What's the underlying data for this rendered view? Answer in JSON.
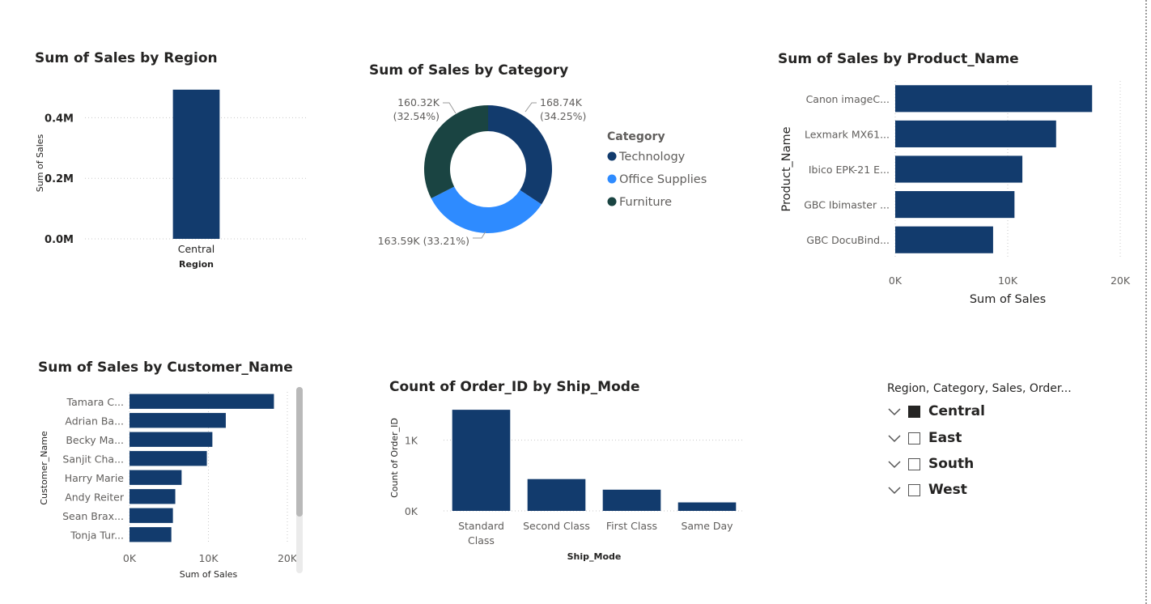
{
  "colors": {
    "primary": "#123B6D",
    "office": "#2E8BFF",
    "furniture": "#1A4442",
    "grid": "#C8C8C8",
    "text": "#252423",
    "muted": "#605E5C"
  },
  "chart_data": [
    {
      "id": "region",
      "type": "bar",
      "title": "Sum of Sales by Region",
      "categories": [
        "Central"
      ],
      "values": [
        492649
      ],
      "xlabel": "Region",
      "ylabel": "Sum of Sales",
      "ylim": [
        0,
        500000
      ],
      "yticks": [
        "0.0M",
        "0.2M",
        "0.4M"
      ],
      "ytick_values": [
        0,
        200000,
        400000
      ],
      "grid": true
    },
    {
      "id": "category",
      "type": "pie",
      "title": "Sum of Sales by Category",
      "categories": [
        "Technology",
        "Office Supplies",
        "Furniture"
      ],
      "values": [
        168740,
        163590,
        160320
      ],
      "data_labels": [
        [
          "168.74K",
          "(34.25%)"
        ],
        [
          "163.59K (33.21%)"
        ],
        [
          "160.32K",
          "(32.54%)"
        ]
      ],
      "legend_title": "Category",
      "legend": "right",
      "donut": true
    },
    {
      "id": "product",
      "type": "bar",
      "orientation": "horizontal",
      "title": "Sum of Sales by Product_Name",
      "categories": [
        "Canon imageC...",
        "Lexmark MX61...",
        "Ibico EPK-21 E...",
        "GBC Ibimaster ...",
        "GBC DocuBind..."
      ],
      "values": [
        17500,
        14300,
        11300,
        10600,
        8700
      ],
      "xlabel": "Sum of Sales",
      "ylabel": "Product_Name",
      "xlim": [
        0,
        20000
      ],
      "xticks": [
        "0K",
        "10K",
        "20K"
      ],
      "xtick_values": [
        0,
        10000,
        20000
      ],
      "grid": true
    },
    {
      "id": "customer",
      "type": "bar",
      "orientation": "horizontal",
      "title": "Sum of Sales by Customer_Name",
      "categories": [
        "Tamara C...",
        "Adrian Ba...",
        "Becky Ma...",
        "Sanjit Cha...",
        "Harry Marie",
        "Andy Reiter",
        "Sean Brax...",
        "Tonja Tur..."
      ],
      "values": [
        18300,
        12200,
        10500,
        9800,
        6600,
        5800,
        5500,
        5300
      ],
      "xlabel": "Sum of Sales",
      "ylabel": "Customer_Name",
      "xlim": [
        0,
        20000
      ],
      "xticks": [
        "0K",
        "10K",
        "20K"
      ],
      "xtick_values": [
        0,
        10000,
        20000
      ],
      "grid": true
    },
    {
      "id": "shipmode",
      "type": "bar",
      "title": "Count of Order_ID by Ship_Mode",
      "categories": [
        [
          "Standard",
          "Class"
        ],
        [
          "Second Class"
        ],
        [
          "First Class"
        ],
        [
          "Same Day"
        ]
      ],
      "values": [
        1430,
        450,
        300,
        120
      ],
      "xlabel": "Ship_Mode",
      "ylabel": "Count of Order_ID",
      "ylim": [
        0,
        1500
      ],
      "yticks": [
        "0K",
        "1K"
      ],
      "ytick_values": [
        0,
        1000
      ],
      "grid": true
    }
  ],
  "slicer": {
    "header": "Region, Category, Sales, Order...",
    "items": [
      {
        "label": "Central",
        "checked": true
      },
      {
        "label": "East",
        "checked": false
      },
      {
        "label": "South",
        "checked": false
      },
      {
        "label": "West",
        "checked": false
      }
    ]
  }
}
